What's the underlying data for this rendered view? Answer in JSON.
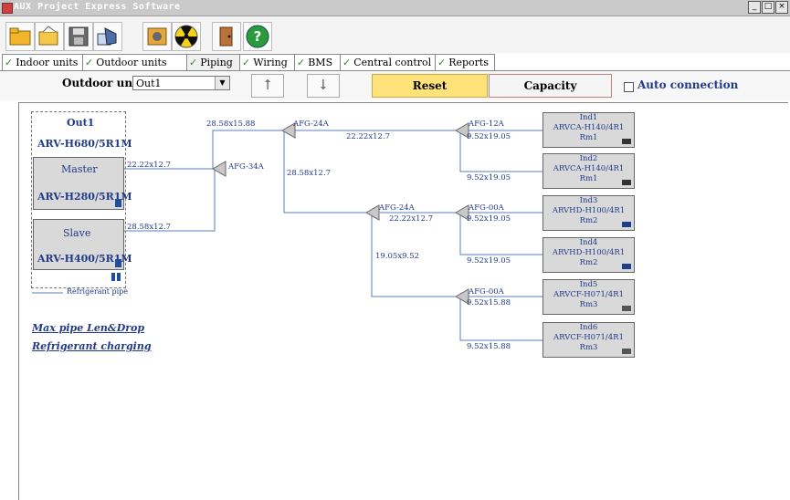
{
  "window": {
    "title": "AUX Project Express    Software",
    "controls": [
      "_",
      "□",
      "×"
    ]
  },
  "toolbar": {
    "icons": [
      "open-folder-icon",
      "open-file-icon",
      "save-icon",
      "export-icon",
      "settings-icon",
      "radiation-icon",
      "exit-icon",
      "help-icon"
    ]
  },
  "tabs": [
    {
      "label": "Indoor units"
    },
    {
      "label": "Outdoor units"
    },
    {
      "label": "Piping"
    },
    {
      "label": "Wiring"
    },
    {
      "label": "BMS"
    },
    {
      "label": "Central control"
    },
    {
      "label": "Reports"
    }
  ],
  "controls": {
    "outdoor_label": "Outdoor units",
    "outdoor_value": "Out1",
    "reset": "Reset",
    "capacity": "Capacity Modification",
    "auto_connection": "Auto connection"
  },
  "outdoor": {
    "name": "Out1",
    "model": "ARV-H680/5R1M",
    "master_label": "Master",
    "master_model": "ARV-H280/5R1M",
    "slave_label": "Slave",
    "slave_model": "ARV-H400/5R1M",
    "legend": "Refrigerant pipe"
  },
  "links": {
    "max_pipe": "Max pipe Len&Drop",
    "charging": "Refrigerant charging"
  },
  "pipes": {
    "master": "22.22x12.7",
    "slave": "28.58x12.7",
    "main_top": "28.58x15.88",
    "vertical_left": "28.58x12.7",
    "afg24_top_out": "22.22x12.7",
    "afg24_mid_out": "22.22x12.7",
    "mid_vertical": "19.05x9.52",
    "ind1": "9.52x19.05",
    "ind2": "9.52x19.05",
    "ind3": "9.52x19.05",
    "ind4": "9.52x19.05",
    "ind5": "9.52x15.88",
    "ind6": "9.52x15.88"
  },
  "branches": {
    "afg34": "AFG-34A",
    "afg24_top": "AFG-24A",
    "afg24_mid": "AFG-24A",
    "afg12": "AFG-12A",
    "afg00_a": "AFG-00A",
    "afg00_b": "AFG-00A"
  },
  "indoor_units": [
    {
      "name": "Ind1",
      "model": "ARVCA-H140/4R1",
      "room": "Rm1"
    },
    {
      "name": "Ind2",
      "model": "ARVCA-H140/4R1",
      "room": "Rm1"
    },
    {
      "name": "Ind3",
      "model": "ARVHD-H100/4R1",
      "room": "Rm2"
    },
    {
      "name": "Ind4",
      "model": "ARVHD-H100/4R1",
      "room": "Rm2"
    },
    {
      "name": "Ind5",
      "model": "ARVCF-H071/4R1",
      "room": "Rm3"
    },
    {
      "name": "Ind6",
      "model": "ARVCF-H071/4R1",
      "room": "Rm3"
    }
  ]
}
